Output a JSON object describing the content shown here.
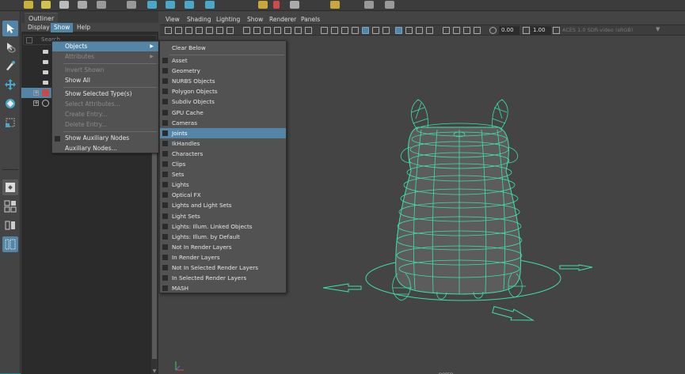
{
  "outliner": {
    "panel_tab": "Outliner",
    "menu": [
      "Display",
      "Show",
      "Help"
    ],
    "search_placeholder": "Search..."
  },
  "viewport": {
    "menu": [
      "View",
      "Shading",
      "Lighting",
      "Show",
      "Renderer",
      "Panels"
    ],
    "exposure": "0.00",
    "gamma": "1.00",
    "color_space": "ACES 1.0 SDR-video (sRGB)",
    "camera_label": "persp"
  },
  "show_menu": {
    "objects": "Objects",
    "attributes": "Attributes",
    "invert_shown": "Invert Shown",
    "show_all": "Show All",
    "show_selected_types": "Show Selected Type(s)",
    "select_attributes": "Select Attributes...",
    "create_entry": "Create Entry...",
    "delete_entry": "Delete Entry...",
    "show_auxiliary_nodes": "Show Auxiliary Nodes",
    "auxiliary_nodes": "Auxiliary Nodes..."
  },
  "objects_menu": {
    "clear_below": "Clear Below",
    "items": [
      "Asset",
      "Geometry",
      "NURBS Objects",
      "Polygon Objects",
      "Subdiv Objects",
      "GPU Cache",
      "Cameras",
      "Joints",
      "IkHandles",
      "Characters",
      "Clips",
      "Sets",
      "Lights",
      "Optical FX",
      "Lights and Light Sets",
      "Light Sets",
      "Lights: Illum. Linked Objects",
      "Lights: Illum. by Default",
      "Not In Render Layers",
      "In Render Layers",
      "Not In Selected Render Layers",
      "In Selected Render Layers",
      "MASH"
    ],
    "highlighted": "Joints"
  },
  "colors": {
    "highlight": "#5285a6",
    "wireframe": "#3ee0a8",
    "menu_bg": "#525252"
  }
}
